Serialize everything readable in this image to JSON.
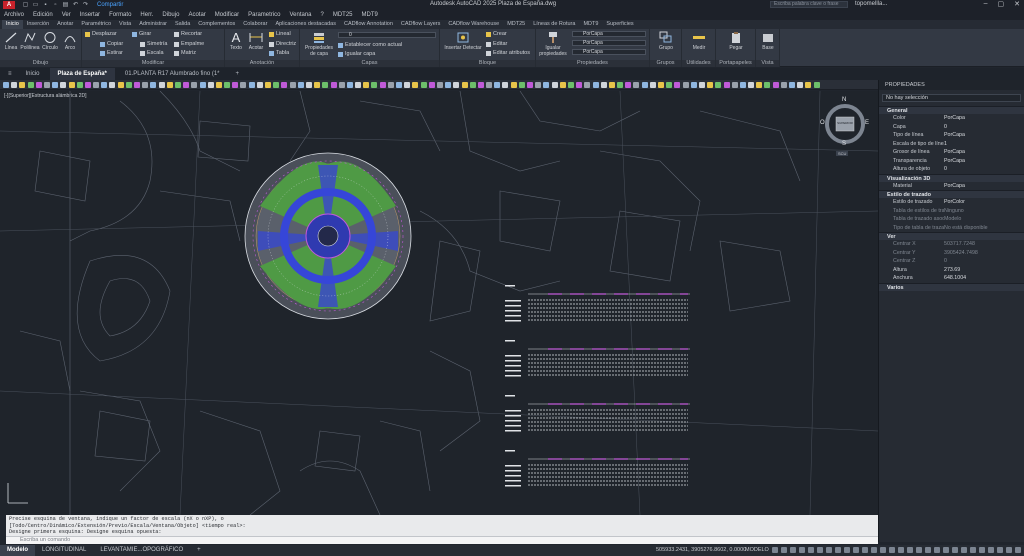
{
  "titlebar": {
    "logo": "A",
    "share": "Compartir",
    "app_title": "Autodesk AutoCAD 2025    Plaza de España.dwg",
    "search_placeholder": "Escriba palabra clave o frase",
    "user": "topomellla..."
  },
  "menu": [
    "Archivo",
    "Edición",
    "Ver",
    "Insertar",
    "Formato",
    "Herr.",
    "Dibujo",
    "Acotar",
    "Modificar",
    "Parametrico",
    "Ventana",
    "?",
    "MDT25",
    "MDT9"
  ],
  "ribbon_tabs": [
    "Inicio",
    "Inserción",
    "Anotar",
    "Paramétrico",
    "Vista",
    "Administrar",
    "Salida",
    "Complementos",
    "Colaborar",
    "Aplicaciones destacadas",
    "CADflow Annotation",
    "CADflow Layers",
    "CADflow Warehouse",
    "MDT25",
    "Líneas de Rotura",
    "MDT9",
    "Superficies"
  ],
  "ribbon": {
    "draw": {
      "title": "Dibujo",
      "line": "Línea",
      "polyline": "Polilínea",
      "circle": "Círculo",
      "arc": "Arco"
    },
    "modify": {
      "title": "Modificar",
      "move": "Desplazar",
      "rotate": "Girar",
      "trim": "Recortar",
      "copy": "Copiar",
      "mirror": "Simetría",
      "fillet": "Empalme",
      "stretch": "Estirar",
      "scale": "Escala",
      "array": "Matriz"
    },
    "annotation": {
      "title": "Anotación",
      "text": "Texto",
      "dimension": "Acotar",
      "linear": "Lineal",
      "leader": "Directriz",
      "table": "Tabla"
    },
    "layers": {
      "title": "Capas",
      "layer_props": "Propiedades de capa",
      "set_current": "Establecer como actual",
      "match_layer": "Igualar capa",
      "current_layer": "0"
    },
    "block": {
      "title": "Bloque",
      "insert": "Insertar",
      "detect": "Detectar",
      "create": "Crear",
      "edit": "Editar",
      "edit_attr": "Editar atributos"
    },
    "properties": {
      "title": "Propiedades",
      "match": "Igualar propiedades",
      "color": "PorCapa",
      "linetype": "PorCapa",
      "lineweight": "PorCapa"
    },
    "groups": {
      "title": "Grupos",
      "group": "Grupo"
    },
    "utilities": {
      "title": "Utilidades",
      "measure": "Medir"
    },
    "clipboard": {
      "title": "Portapapeles",
      "paste": "Pegar"
    },
    "view": {
      "title": "Vista",
      "base": "Base"
    }
  },
  "doc_tabs": [
    "Inicio",
    "Plaza de España*",
    "01.PLANTA R17 Alumbrado fino (1*"
  ],
  "viewport_label": "[-][Superior][Estructura alámbrica 2D]",
  "viewcube": {
    "n": "N",
    "s": "S",
    "e": "E",
    "o": "O",
    "face": "SUPERIOR",
    "wcs": "SCU"
  },
  "properties_panel": {
    "title": "PROPIEDADES",
    "selection": "No hay selección",
    "sections": [
      {
        "name": "General",
        "rows": [
          {
            "k": "Color",
            "v": "PorCapa"
          },
          {
            "k": "Capa",
            "v": "0"
          },
          {
            "k": "Tipo de línea",
            "v": "PorCapa"
          },
          {
            "k": "Escala de tipo de línea",
            "v": "1"
          },
          {
            "k": "Grosor de línea",
            "v": "PorCapa"
          },
          {
            "k": "Transparencia",
            "v": "PorCapa"
          },
          {
            "k": "Altura de objeto",
            "v": "0"
          }
        ]
      },
      {
        "name": "Visualización 3D",
        "rows": [
          {
            "k": "Material",
            "v": "PorCapa"
          }
        ]
      },
      {
        "name": "Estilo de trazado",
        "rows": [
          {
            "k": "Estilo de trazado",
            "v": "PorColor"
          },
          {
            "k": "Tabla de estilos de traz...",
            "v": "Ninguno"
          },
          {
            "k": "Tabla de trazado asoci...",
            "v": "Modelo"
          },
          {
            "k": "Tipo de tabla de trazado",
            "v": "No está disponible"
          }
        ]
      },
      {
        "name": "Ver",
        "rows": [
          {
            "k": "Centrar X",
            "v": "503717.7248"
          },
          {
            "k": "Centrar Y",
            "v": "3905424.7498"
          },
          {
            "k": "Centrar Z",
            "v": "0"
          },
          {
            "k": "Altura",
            "v": "273.69"
          },
          {
            "k": "Anchura",
            "v": "648.1004"
          }
        ]
      },
      {
        "name": "Varios",
        "rows": []
      }
    ]
  },
  "command": {
    "history": [
      "Precise esquina de ventana, indique un factor de escala (nX o nXP), o",
      "[Todo/Centro/Dinámico/Extensión/Previo/Escala/Ventana/Objeto] <tiempo real>:",
      "Designe primera esquina: Designe esquina opuesta:"
    ],
    "placeholder": "Escriba un comando"
  },
  "status": {
    "layouts": [
      "Modelo",
      "LONGITUDINAL",
      "LEVANTAMIE...OPOGRÁFICO"
    ],
    "coords": "505933.2431, 3905276.8602, 0.0000",
    "mode": "MODELO"
  }
}
